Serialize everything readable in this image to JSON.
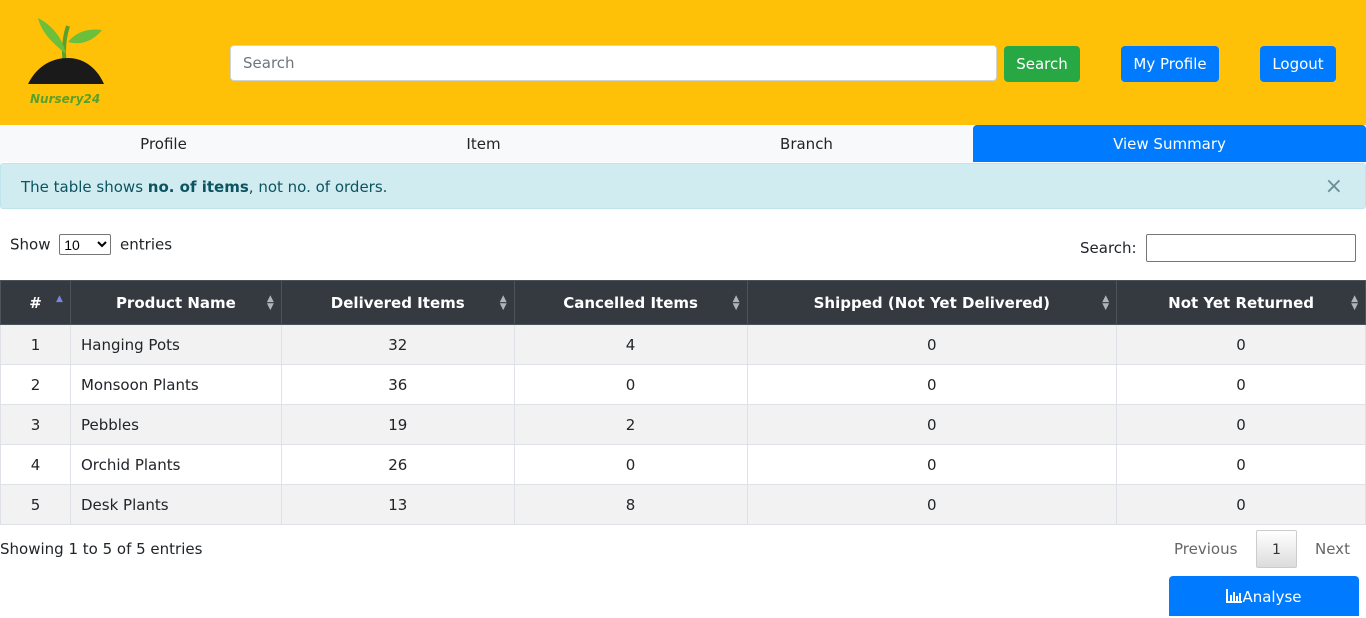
{
  "brand": {
    "name": "Nursery24"
  },
  "header": {
    "search_placeholder": "Search",
    "search_button": "Search",
    "profile_button": "My Profile",
    "logout_button": "Logout"
  },
  "nav": {
    "tabs": [
      {
        "label": "Profile"
      },
      {
        "label": "Item"
      },
      {
        "label": "Branch"
      },
      {
        "label": "View Summary"
      }
    ]
  },
  "alert": {
    "prefix": "The table shows ",
    "bold": "no. of items",
    "suffix": ", not no. of orders.",
    "close": "×"
  },
  "controls": {
    "show_label": "Show",
    "entries_label": "entries",
    "page_size": "10",
    "search_label": "Search:"
  },
  "table": {
    "columns": [
      "#",
      "Product Name",
      "Delivered Items",
      "Cancelled Items",
      "Shipped (Not Yet Delivered)",
      "Not Yet Returned"
    ],
    "rows": [
      [
        "1",
        "Hanging Pots",
        "32",
        "4",
        "0",
        "0"
      ],
      [
        "2",
        "Monsoon Plants",
        "36",
        "0",
        "0",
        "0"
      ],
      [
        "3",
        "Pebbles",
        "19",
        "2",
        "0",
        "0"
      ],
      [
        "4",
        "Orchid Plants",
        "26",
        "0",
        "0",
        "0"
      ],
      [
        "5",
        "Desk Plants",
        "13",
        "8",
        "0",
        "0"
      ]
    ]
  },
  "footer": {
    "info": "Showing 1 to 5 of 5 entries",
    "previous": "Previous",
    "page": "1",
    "next": "Next",
    "analyse": "Analyse"
  },
  "colors": {
    "header_bg": "#ffc107",
    "primary": "#007bff",
    "success": "#28a745",
    "table_head": "#343a40"
  }
}
